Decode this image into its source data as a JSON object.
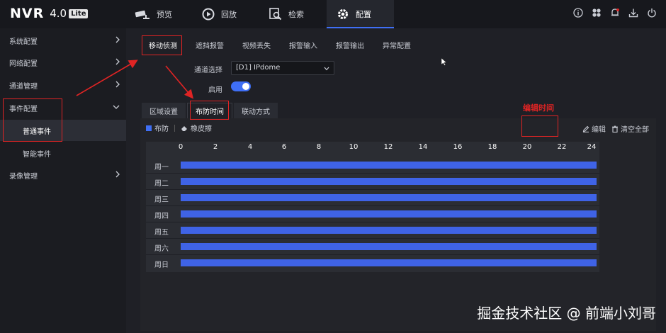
{
  "logo": {
    "brand": "NVR",
    "version": "4.0",
    "badge": "Lite"
  },
  "top_tabs": [
    {
      "label": "预览",
      "icon": "camera-icon"
    },
    {
      "label": "回放",
      "icon": "playback-icon"
    },
    {
      "label": "检索",
      "icon": "search-icon"
    },
    {
      "label": "配置",
      "icon": "gear-icon"
    }
  ],
  "top_icons": [
    "info-icon",
    "fan-icon",
    "bell-icon",
    "download-icon",
    "logout-icon"
  ],
  "sidebar": {
    "items": [
      {
        "label": "系统配置"
      },
      {
        "label": "网络配置"
      },
      {
        "label": "通道管理"
      },
      {
        "label": "事件配置"
      },
      {
        "label": "普通事件"
      },
      {
        "label": "智能事件"
      },
      {
        "label": "录像管理"
      }
    ]
  },
  "sub_tabs": [
    "移动侦测",
    "遮挡报警",
    "视频丢失",
    "报警输入",
    "报警输出",
    "异常配置"
  ],
  "channel": {
    "label": "通道选择",
    "value": "[D1] IPdome"
  },
  "enable": {
    "label": "启用",
    "on": true
  },
  "inner_tabs": [
    "区域设置",
    "布防时间",
    "联动方式"
  ],
  "legend": {
    "arm": "布防",
    "eraser": "橡皮擦"
  },
  "actions": {
    "edit": "编辑",
    "clear": "清空全部"
  },
  "annotation": "编辑时间",
  "schedule": {
    "hours": [
      "0",
      "2",
      "4",
      "6",
      "8",
      "10",
      "12",
      "14",
      "16",
      "18",
      "20",
      "22",
      "24"
    ],
    "days": [
      "周一",
      "周二",
      "周三",
      "周四",
      "周五",
      "周六",
      "周日"
    ],
    "armed_from": 0,
    "armed_to": 24
  },
  "colors": {
    "accent": "#3f6ff5",
    "bar": "#3f63e6",
    "annotation": "#e02424"
  },
  "watermark": "掘金技术社区 @ 前端小刘哥"
}
